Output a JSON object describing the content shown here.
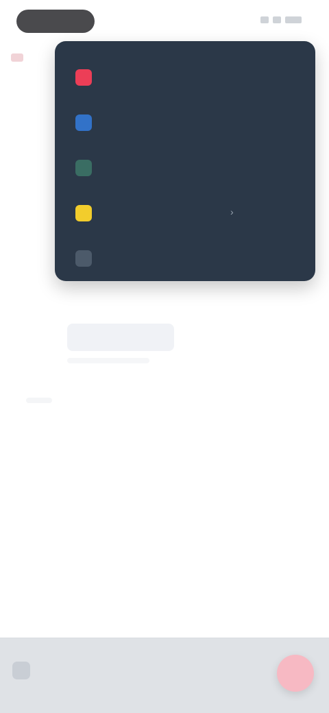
{
  "menu": {
    "items": [
      {
        "label": "",
        "icon": "alert-icon",
        "color": "#ec3e57"
      },
      {
        "label": "",
        "icon": "folder-icon",
        "color": "#3272c8"
      },
      {
        "label": "",
        "icon": "document-icon",
        "color": "#3a6d63"
      },
      {
        "label": "",
        "icon": "star-icon",
        "color": "#f2cd2c"
      },
      {
        "label": "",
        "icon": "settings-icon",
        "color": "#4c5a6a"
      }
    ]
  },
  "status": {
    "time": ""
  },
  "bottom": {
    "action_color": "#f7b9c3"
  }
}
